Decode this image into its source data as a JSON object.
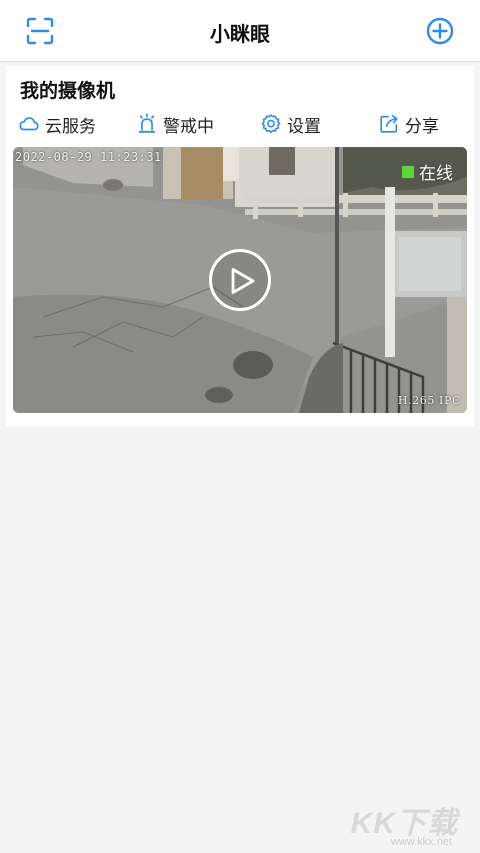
{
  "header": {
    "title": "小眯眼",
    "scan_icon": "scan-icon",
    "add_icon": "plus-circle-icon",
    "accent": "#2f8be6"
  },
  "camera": {
    "name": "我的摄像机",
    "actions": [
      {
        "label": "云服务",
        "icon": "cloud-icon"
      },
      {
        "label": "警戒中",
        "icon": "alarm-icon"
      },
      {
        "label": "设置",
        "icon": "gear-icon"
      },
      {
        "label": "分享",
        "icon": "share-icon"
      }
    ],
    "feed": {
      "timestamp": "2022-08-29 11:23:31",
      "status": "在线",
      "status_color": "#5cd63b",
      "codec": "H.265 IPC",
      "play_icon": "play-icon"
    }
  },
  "watermark": {
    "text": "KK下载",
    "url": "www.kkx.net"
  }
}
